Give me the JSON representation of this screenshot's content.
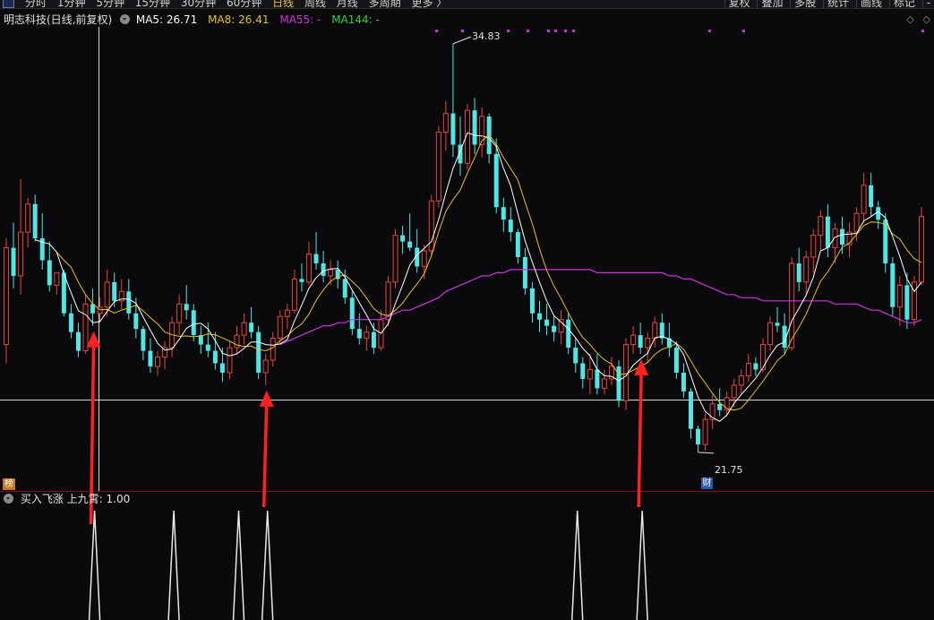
{
  "toolbar": {
    "periods": [
      "分时",
      "1分钟",
      "5分钟",
      "15分钟",
      "30分钟",
      "60分钟",
      "日线",
      "周线",
      "月线",
      "多周期",
      "更多 〉"
    ],
    "active_period_index": 6,
    "tools": [
      "复权",
      "叠加",
      "多股",
      "统计",
      "画线",
      "标记",
      "-"
    ]
  },
  "main_title": {
    "stock": "明志科技(日线,前复权)",
    "ma5_text": "MA5: 26.71",
    "ma8_text": "MA8: 26.41",
    "ma55_text": "MA55: -",
    "ma144_text": "MA144: -"
  },
  "title_right_icons": [
    "◇",
    "◇"
  ],
  "sub_title": "买入飞涨 上九霄: 1.00",
  "badges": {
    "bang": "榜",
    "cai": "财"
  },
  "colors": {
    "up": "#e8453c",
    "down": "#4fe6e6",
    "ma5": "#ffffff",
    "ma8": "#e8c020",
    "ma55": "#d030e0",
    "ma144": "#30d040",
    "arrow": "#ff2020",
    "divider": "#7a1010"
  },
  "chart_data": {
    "type": "candlestick",
    "y_range": [
      21.2,
      35.2
    ],
    "high_label": "34.83",
    "low_label": "21.75",
    "price_marker_level": 23.45,
    "crosshair_bar_index": 12,
    "arrow_bar_indices": [
      12,
      36,
      88
    ],
    "signal_bar_indices": [
      12,
      23,
      32,
      36,
      79,
      88
    ],
    "candles": [
      [
        25.2,
        28.6,
        24.6,
        28.3
      ],
      [
        28.3,
        29.1,
        27.0,
        27.4
      ],
      [
        27.4,
        30.5,
        26.8,
        28.8
      ],
      [
        28.8,
        29.9,
        28.3,
        29.7
      ],
      [
        29.7,
        30.0,
        28.5,
        28.6
      ],
      [
        28.6,
        29.4,
        27.6,
        27.9
      ],
      [
        27.9,
        28.5,
        26.9,
        27.1
      ],
      [
        27.1,
        27.5,
        26.8,
        27.5
      ],
      [
        27.5,
        27.6,
        26.1,
        26.2
      ],
      [
        26.2,
        26.5,
        25.4,
        25.6
      ],
      [
        25.6,
        25.9,
        24.8,
        25.0
      ],
      [
        25.0,
        26.8,
        24.9,
        26.5
      ],
      [
        26.5,
        27.0,
        25.8,
        26.2
      ],
      [
        26.2,
        26.7,
        25.9,
        26.4
      ],
      [
        26.4,
        27.6,
        26.1,
        27.2
      ],
      [
        27.2,
        27.5,
        26.4,
        26.6
      ],
      [
        26.6,
        27.3,
        26.3,
        26.9
      ],
      [
        26.9,
        27.3,
        26.0,
        26.2
      ],
      [
        26.2,
        26.7,
        25.4,
        25.7
      ],
      [
        25.7,
        25.8,
        24.7,
        25.0
      ],
      [
        25.0,
        25.4,
        24.3,
        24.5
      ],
      [
        24.5,
        25.0,
        24.2,
        24.8
      ],
      [
        24.8,
        25.3,
        24.4,
        25.1
      ],
      [
        25.1,
        26.1,
        24.8,
        25.9
      ],
      [
        25.9,
        26.8,
        25.5,
        26.5
      ],
      [
        26.5,
        27.1,
        26.0,
        26.3
      ],
      [
        26.3,
        26.5,
        25.3,
        25.5
      ],
      [
        25.5,
        25.8,
        24.9,
        25.2
      ],
      [
        25.2,
        25.9,
        24.8,
        25.0
      ],
      [
        25.0,
        25.6,
        24.4,
        24.6
      ],
      [
        24.6,
        25.1,
        24.0,
        24.3
      ],
      [
        24.3,
        25.3,
        24.1,
        25.1
      ],
      [
        25.1,
        25.8,
        24.9,
        25.5
      ],
      [
        25.5,
        26.2,
        25.2,
        25.9
      ],
      [
        25.9,
        26.4,
        25.4,
        25.6
      ],
      [
        25.6,
        25.8,
        24.1,
        24.3
      ],
      [
        24.3,
        24.9,
        23.9,
        24.7
      ],
      [
        24.7,
        25.6,
        24.5,
        25.4
      ],
      [
        25.4,
        26.3,
        25.2,
        26.1
      ],
      [
        26.1,
        26.5,
        25.7,
        26.3
      ],
      [
        26.3,
        27.6,
        26.2,
        27.3
      ],
      [
        27.3,
        27.8,
        26.9,
        27.2
      ],
      [
        27.2,
        28.5,
        27.1,
        28.1
      ],
      [
        28.1,
        28.8,
        27.6,
        27.8
      ],
      [
        27.8,
        28.2,
        27.2,
        27.4
      ],
      [
        27.4,
        27.9,
        27.1,
        27.6
      ],
      [
        27.6,
        27.9,
        27.0,
        27.3
      ],
      [
        27.3,
        27.6,
        26.5,
        26.7
      ],
      [
        26.7,
        26.9,
        25.5,
        25.7
      ],
      [
        25.7,
        26.2,
        25.2,
        25.4
      ],
      [
        25.4,
        25.8,
        25.0,
        25.6
      ],
      [
        25.6,
        25.9,
        24.9,
        25.1
      ],
      [
        25.1,
        26.3,
        25.0,
        26.0
      ],
      [
        26.0,
        27.4,
        25.8,
        27.2
      ],
      [
        27.2,
        28.9,
        27.0,
        28.7
      ],
      [
        28.7,
        29.0,
        28.1,
        28.5
      ],
      [
        28.5,
        29.4,
        28.2,
        28.3
      ],
      [
        28.3,
        28.9,
        27.5,
        27.7
      ],
      [
        27.7,
        28.4,
        27.3,
        28.2
      ],
      [
        28.2,
        30.0,
        28.0,
        29.8
      ],
      [
        29.8,
        32.2,
        29.6,
        32.0
      ],
      [
        32.0,
        33.0,
        31.4,
        32.6
      ],
      [
        32.6,
        34.83,
        31.2,
        31.6
      ],
      [
        31.6,
        32.5,
        30.6,
        31.0
      ],
      [
        31.0,
        32.9,
        30.8,
        32.7
      ],
      [
        32.7,
        33.1,
        31.3,
        31.6
      ],
      [
        31.6,
        32.8,
        31.2,
        32.5
      ],
      [
        32.5,
        32.6,
        31.0,
        31.3
      ],
      [
        31.3,
        31.8,
        29.4,
        29.6
      ],
      [
        29.6,
        29.9,
        28.8,
        29.2
      ],
      [
        29.2,
        29.6,
        28.5,
        28.8
      ],
      [
        28.8,
        28.9,
        27.8,
        28.0
      ],
      [
        28.0,
        28.3,
        26.8,
        27.0
      ],
      [
        27.0,
        27.2,
        25.9,
        26.2
      ],
      [
        26.2,
        26.6,
        25.6,
        26.0
      ],
      [
        26.0,
        26.5,
        25.5,
        25.8
      ],
      [
        25.8,
        26.1,
        25.3,
        25.6
      ],
      [
        25.6,
        26.3,
        25.2,
        26.0
      ],
      [
        26.0,
        26.2,
        24.9,
        25.1
      ],
      [
        25.1,
        25.4,
        24.3,
        24.6
      ],
      [
        24.6,
        24.8,
        23.8,
        24.1
      ],
      [
        24.1,
        24.9,
        23.6,
        24.4
      ],
      [
        24.4,
        24.9,
        23.6,
        23.8
      ],
      [
        23.8,
        24.4,
        23.6,
        24.1
      ],
      [
        24.1,
        24.8,
        23.9,
        24.5
      ],
      [
        24.5,
        24.7,
        23.2,
        23.4
      ],
      [
        23.4,
        25.4,
        23.1,
        25.2
      ],
      [
        25.2,
        25.8,
        24.9,
        25.5
      ],
      [
        25.5,
        25.9,
        24.9,
        25.1
      ],
      [
        25.1,
        25.6,
        24.6,
        25.4
      ],
      [
        25.4,
        26.1,
        25.1,
        25.9
      ],
      [
        25.9,
        26.2,
        25.2,
        25.4
      ],
      [
        25.4,
        25.9,
        24.8,
        25.1
      ],
      [
        25.1,
        25.3,
        24.1,
        24.3
      ],
      [
        24.3,
        24.6,
        23.5,
        23.7
      ],
      [
        23.7,
        23.8,
        22.2,
        22.5
      ],
      [
        22.5,
        22.6,
        21.75,
        22.0
      ],
      [
        22.0,
        23.0,
        21.8,
        22.8
      ],
      [
        22.8,
        23.6,
        22.5,
        23.3
      ],
      [
        23.3,
        23.8,
        22.9,
        23.1
      ],
      [
        23.1,
        23.7,
        22.9,
        23.5
      ],
      [
        23.5,
        24.1,
        23.2,
        23.9
      ],
      [
        23.9,
        24.4,
        23.6,
        24.2
      ],
      [
        24.2,
        24.9,
        24.0,
        24.6
      ],
      [
        24.6,
        24.8,
        24.2,
        24.4
      ],
      [
        24.4,
        25.4,
        24.3,
        25.2
      ],
      [
        25.2,
        26.1,
        25.0,
        25.9
      ],
      [
        25.9,
        26.4,
        25.6,
        25.8
      ],
      [
        25.8,
        26.2,
        24.9,
        25.1
      ],
      [
        25.1,
        28.0,
        25.0,
        27.8
      ],
      [
        27.8,
        28.3,
        26.9,
        27.2
      ],
      [
        27.2,
        28.2,
        26.8,
        28.0
      ],
      [
        28.0,
        28.9,
        27.5,
        28.7
      ],
      [
        28.7,
        29.5,
        28.2,
        29.3
      ],
      [
        29.3,
        29.7,
        28.0,
        28.3
      ],
      [
        28.3,
        29.1,
        27.8,
        28.9
      ],
      [
        28.9,
        29.3,
        28.1,
        28.4
      ],
      [
        28.4,
        29.1,
        28.0,
        28.8
      ],
      [
        28.8,
        29.6,
        28.5,
        29.4
      ],
      [
        29.4,
        30.7,
        29.1,
        30.3
      ],
      [
        30.3,
        30.7,
        29.3,
        29.6
      ],
      [
        29.6,
        29.8,
        28.9,
        29.2
      ],
      [
        29.2,
        29.4,
        27.5,
        27.8
      ],
      [
        27.8,
        28.0,
        26.1,
        26.4
      ],
      [
        26.4,
        27.4,
        25.8,
        27.1
      ],
      [
        27.1,
        27.5,
        25.7,
        26.0
      ],
      [
        26.0,
        27.4,
        25.8,
        27.2
      ],
      [
        27.2,
        29.6,
        27.1,
        29.3
      ]
    ],
    "ma55": [
      null,
      null,
      null,
      null,
      null,
      null,
      null,
      null,
      null,
      null,
      null,
      null,
      null,
      null,
      null,
      null,
      null,
      null,
      null,
      null,
      null,
      null,
      null,
      null,
      null,
      null,
      null,
      null,
      null,
      null,
      null,
      null,
      null,
      null,
      null,
      null,
      null,
      null,
      25.2,
      25.3,
      25.4,
      25.5,
      25.6,
      25.7,
      25.8,
      25.8,
      25.9,
      25.9,
      26.0,
      26.0,
      26.0,
      26.0,
      26.0,
      26.1,
      26.2,
      26.3,
      26.3,
      26.4,
      26.5,
      26.6,
      26.7,
      26.9,
      27.0,
      27.1,
      27.2,
      27.3,
      27.4,
      27.4,
      27.5,
      27.5,
      27.6,
      27.6,
      27.6,
      27.6,
      27.6,
      27.6,
      27.6,
      27.6,
      27.6,
      27.6,
      27.6,
      27.6,
      27.5,
      27.5,
      27.5,
      27.5,
      27.5,
      27.5,
      27.5,
      27.5,
      27.5,
      27.5,
      27.4,
      27.4,
      27.3,
      27.3,
      27.2,
      27.1,
      27.0,
      26.9,
      26.8,
      26.8,
      26.7,
      26.7,
      26.7,
      26.6,
      26.6,
      26.6,
      26.6,
      26.6,
      26.6,
      26.6,
      26.6,
      26.6,
      26.6,
      26.5,
      26.5,
      26.5,
      26.5,
      26.4,
      26.3,
      26.3,
      26.2,
      26.1,
      26.0,
      25.9,
      25.9,
      26.0
    ]
  }
}
